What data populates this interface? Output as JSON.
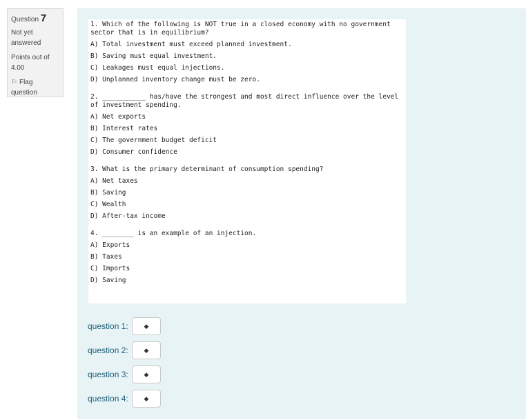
{
  "info": {
    "question_label": "Question",
    "question_number": "7",
    "state": "Not yet answered",
    "grade": "Points out of 4.00",
    "flag_label": "Flag question"
  },
  "questions": [
    {
      "stem": "1. Which of the following is NOT true in a closed economy with no government sector that is in equilibrium?",
      "options": [
        "A) Total investment must exceed planned investment.",
        "B) Saving must equal investment.",
        "C) Leakages must equal injections.",
        "D) Unplanned inventory change must be zero."
      ]
    },
    {
      "stem": "2. ___________ has/have the strongest and most direct influence over the level of investment spending.",
      "options": [
        "A) Net exports",
        "B) Interest rates",
        "C) The government budget deficit",
        "D) Consumer confidence"
      ]
    },
    {
      "stem": "3. What is the primary determinant of consumption spending?",
      "options": [
        "A) Net taxes",
        "B) Saving",
        "C) Wealth",
        "D) After-tax income"
      ]
    },
    {
      "stem": "4. ________ is an example of an injection.",
      "options": [
        "A) Exports",
        "B) Taxes",
        "C) Imports",
        "D) Saving"
      ]
    }
  ],
  "answers": [
    {
      "label": "question 1:",
      "value": ""
    },
    {
      "label": "question 2:",
      "value": ""
    },
    {
      "label": "question 3:",
      "value": ""
    },
    {
      "label": "question 4:",
      "value": ""
    }
  ],
  "icons": {
    "flag": "flag-icon",
    "select_arrow": "updown-arrow-icon"
  }
}
